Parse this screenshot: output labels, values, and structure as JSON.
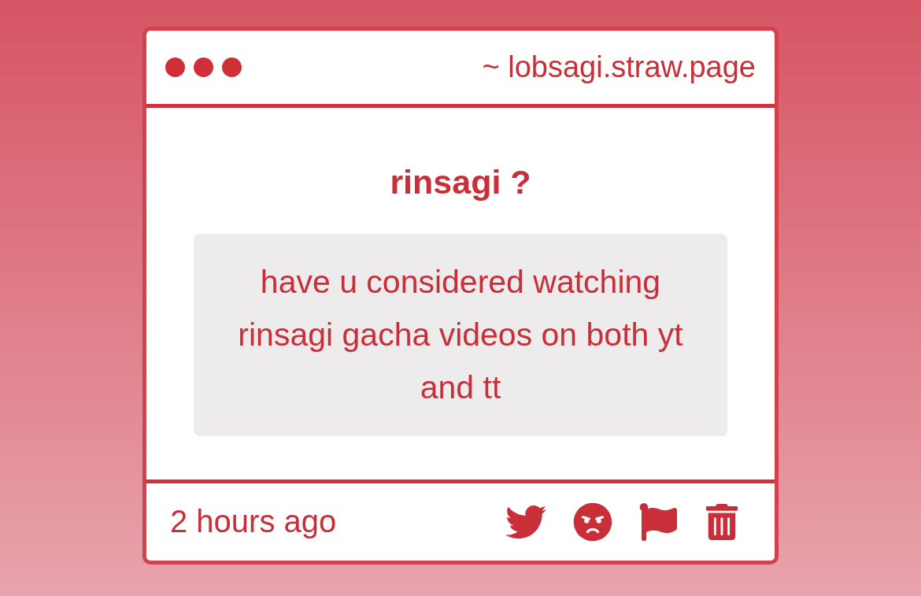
{
  "window": {
    "url": "~ lobsagi.straw.page"
  },
  "question": {
    "title": "rinsagi ?",
    "message": "have u considered watching rinsagi gacha videos on both yt and tt"
  },
  "footer": {
    "time": "2 hours ago"
  }
}
